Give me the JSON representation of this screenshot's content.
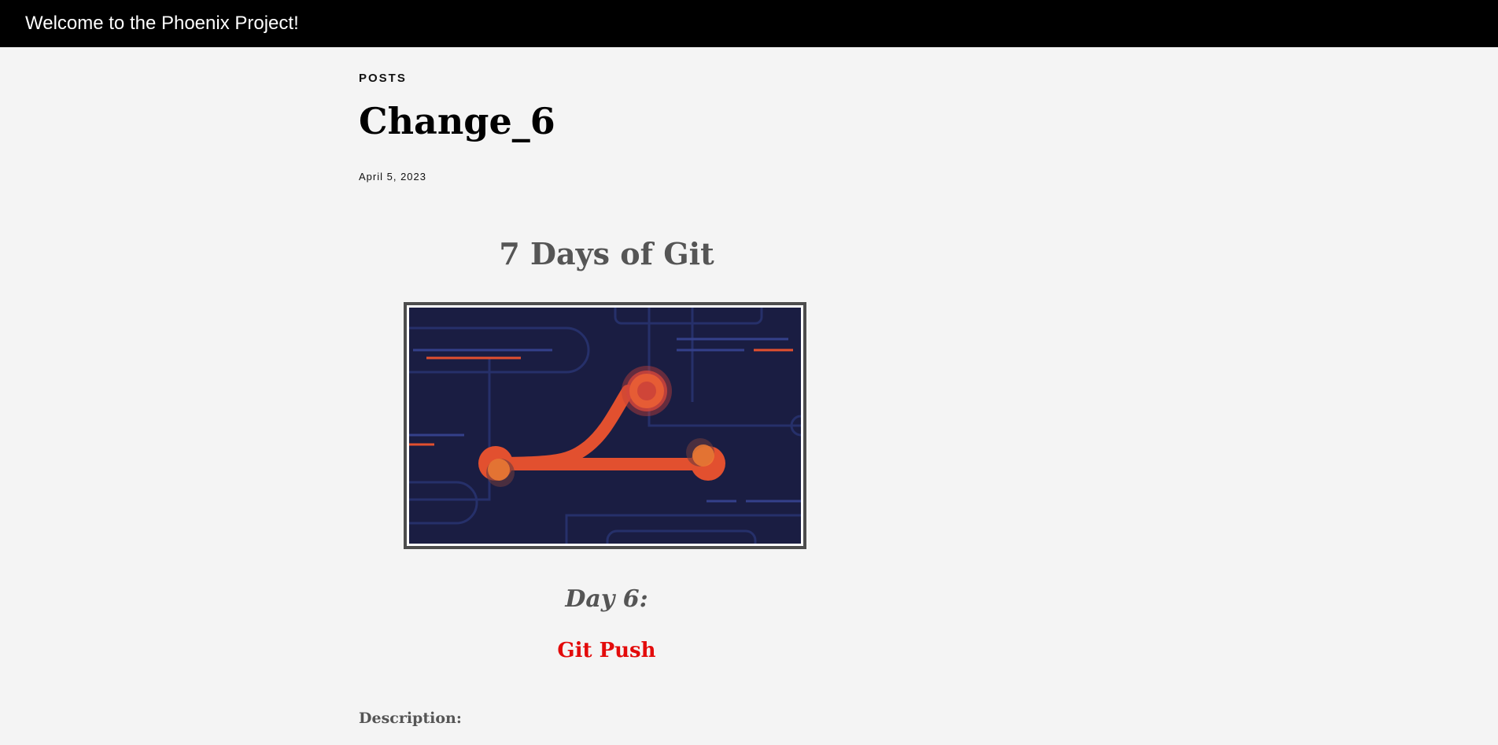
{
  "header": {
    "site_title": "Welcome to the Phoenix Project!"
  },
  "post": {
    "category": "POSTS",
    "title": "Change_6",
    "date": "April 5, 2023"
  },
  "article": {
    "series_title": "7 Days of Git",
    "hero_image_icon": "git-branch-illustration",
    "day_label": "Day 6:",
    "day_topic": "Git Push",
    "description_label": "Description:"
  },
  "colors": {
    "topbar": "#000000",
    "background": "#f4f4f4",
    "topic_red": "#e30b0b",
    "heading_gray": "#555555",
    "illustration_navy": "#1a1d42",
    "illustration_orange": "#e2502f"
  }
}
